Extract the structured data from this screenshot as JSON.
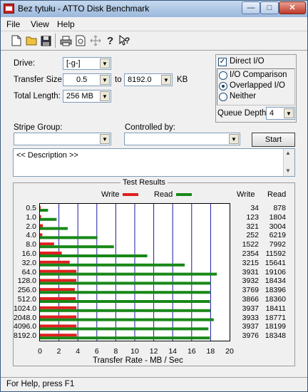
{
  "window": {
    "title": "Bez tytułu - ATTO Disk Benchmark"
  },
  "menu": [
    "File",
    "View",
    "Help"
  ],
  "toolbar_icons": [
    "new-icon",
    "open-icon",
    "save-icon",
    "print-icon",
    "print-preview-icon",
    "move-icon",
    "help-icon",
    "context-help-icon"
  ],
  "form": {
    "drive_label": "Drive:",
    "drive_value": "[-g-]",
    "transfer_size_label": "Transfer Size:",
    "transfer_from": "0.5",
    "to_label": "to",
    "transfer_to": "8192.0",
    "kb_label": "KB",
    "total_length_label": "Total Length:",
    "total_length_value": "256 MB",
    "direct_io_label": "Direct I/O",
    "direct_io_checked": true,
    "io_comparison_label": "I/O Comparison",
    "overlapped_io_label": "Overlapped I/O",
    "neither_label": "Neither",
    "selected_mode": "Overlapped I/O",
    "queue_depth_label": "Queue Depth:",
    "queue_depth_value": "4",
    "stripe_group_label": "Stripe Group:",
    "stripe_group_value": "",
    "controlled_by_label": "Controlled by:",
    "controlled_by_value": "",
    "start_label": "Start",
    "description": "<< Description >>"
  },
  "results": {
    "title": "Test Results",
    "legend_write": "Write",
    "legend_read": "Read",
    "col_write": "Write",
    "col_read": "Read",
    "write_color": "#e02020",
    "read_color": "#188818",
    "xlabel": "Transfer Rate - MB / Sec",
    "xticks": [
      "0",
      "2",
      "4",
      "6",
      "8",
      "10",
      "12",
      "14",
      "16",
      "18",
      "20"
    ]
  },
  "chart_data": {
    "type": "bar",
    "orientation": "horizontal",
    "title": "Test Results",
    "xlabel": "Transfer Rate - MB / Sec",
    "xlim": [
      0,
      20
    ],
    "categories": [
      "0.5",
      "1.0",
      "2.0",
      "4.0",
      "8.0",
      "16.0",
      "32.0",
      "64.0",
      "128.0",
      "256.0",
      "512.0",
      "1024.0",
      "2048.0",
      "4096.0",
      "8192.0"
    ],
    "series": [
      {
        "name": "Write",
        "values": [
          0.03,
          0.12,
          0.31,
          0.25,
          1.49,
          2.3,
          3.14,
          3.84,
          3.84,
          3.68,
          3.78,
          3.84,
          3.84,
          3.84,
          3.88
        ]
      },
      {
        "name": "Read",
        "values": [
          0.86,
          1.76,
          2.93,
          6.07,
          7.8,
          11.32,
          15.27,
          18.66,
          18.0,
          17.96,
          17.93,
          17.98,
          18.33,
          17.77,
          17.92
        ]
      }
    ],
    "write_numbers": [
      "34",
      "123",
      "321",
      "252",
      "1522",
      "2354",
      "3215",
      "3931",
      "3932",
      "3769",
      "3866",
      "3937",
      "3933",
      "3937",
      "3976"
    ],
    "read_numbers": [
      "878",
      "1804",
      "3004",
      "6219",
      "7992",
      "11592",
      "15641",
      "19106",
      "18434",
      "18396",
      "18360",
      "18411",
      "18771",
      "18199",
      "18348"
    ],
    "grid": true,
    "legend": "top"
  },
  "status": {
    "text": "For Help, press F1"
  }
}
